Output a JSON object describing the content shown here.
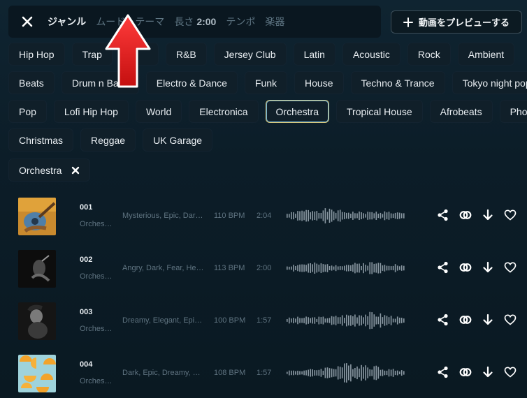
{
  "filter_tabs": [
    {
      "label": "ジャンル",
      "active": true
    },
    {
      "label": "ムード",
      "active": false
    },
    {
      "label": "テーマ",
      "active": false
    },
    {
      "label": "長さ",
      "active": false,
      "value": "2:00"
    },
    {
      "label": "テンポ",
      "active": false
    },
    {
      "label": "楽器",
      "active": false
    }
  ],
  "preview_button": {
    "label": "動画をプレビューする"
  },
  "genres": {
    "row1": [
      "Hip Hop",
      "Trap",
      "",
      "R&B",
      "Jersey Club",
      "Latin",
      "Acoustic",
      "Rock",
      "Ambient"
    ],
    "row2": [
      "Beats",
      "Drum n Bass",
      "Electro & Dance",
      "Funk",
      "House",
      "Techno & Trance",
      "Tokyo night pop"
    ],
    "row3": [
      "Pop",
      "Lofi Hip Hop",
      "World",
      "Electronica",
      "Orchestra",
      "Tropical House",
      "Afrobeats",
      "Phonk"
    ],
    "row4": [
      "Christmas",
      "Reggae",
      "UK Garage"
    ]
  },
  "selected_genre": "Orchestra",
  "active_filter": {
    "label": "Orchestra"
  },
  "tracks": [
    {
      "num": "001",
      "category": "Orches…",
      "tags": "Mysterious, Epic, Dar…",
      "bpm": "110 BPM",
      "duration": "2:04"
    },
    {
      "num": "002",
      "category": "Orches…",
      "tags": "Angry, Dark, Fear, He…",
      "bpm": "113 BPM",
      "duration": "2:00"
    },
    {
      "num": "003",
      "category": "Orches…",
      "tags": "Dreamy, Elegant, Epi…",
      "bpm": "100 BPM",
      "duration": "1:57"
    },
    {
      "num": "004",
      "category": "Orches…",
      "tags": "Dark, Epic, Dreamy, …",
      "bpm": "108 BPM",
      "duration": "1:57"
    }
  ],
  "colors": {
    "accent_red": "#e01e1e",
    "selected_border": "#d8c77a"
  }
}
